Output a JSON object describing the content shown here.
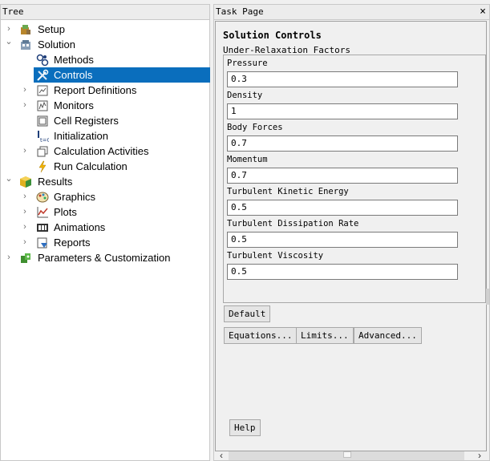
{
  "tree": {
    "header": "Tree",
    "items": [
      {
        "label": "Setup",
        "arrow": "›",
        "icon": "setup-icon"
      },
      {
        "label": "Solution",
        "arrow": "⌄",
        "icon": "solution-icon"
      },
      {
        "label": "Methods",
        "arrow": "",
        "icon": "methods-icon"
      },
      {
        "label": "Controls",
        "arrow": "",
        "icon": "controls-icon"
      },
      {
        "label": "Report Definitions",
        "arrow": "›",
        "icon": "report-definitions-icon"
      },
      {
        "label": "Monitors",
        "arrow": "›",
        "icon": "monitors-icon"
      },
      {
        "label": "Cell Registers",
        "arrow": "",
        "icon": "cell-registers-icon"
      },
      {
        "label": "Initialization",
        "arrow": "",
        "icon": "initialization-icon"
      },
      {
        "label": "Calculation Activities",
        "arrow": "›",
        "icon": "calculation-activities-icon"
      },
      {
        "label": "Run Calculation",
        "arrow": "",
        "icon": "run-calculation-icon"
      },
      {
        "label": "Results",
        "arrow": "⌄",
        "icon": "results-icon"
      },
      {
        "label": "Graphics",
        "arrow": "›",
        "icon": "graphics-icon"
      },
      {
        "label": "Plots",
        "arrow": "›",
        "icon": "plots-icon"
      },
      {
        "label": "Animations",
        "arrow": "›",
        "icon": "animations-icon"
      },
      {
        "label": "Reports",
        "arrow": "›",
        "icon": "reports-icon"
      },
      {
        "label": "Parameters & Customization",
        "arrow": "›",
        "icon": "parameters-icon"
      }
    ],
    "selected": "Controls",
    "selection_color": "#0a6ebd"
  },
  "task": {
    "header": "Task Page",
    "close": "×",
    "title": "Solution Controls",
    "group_label": "Under-Relaxation Factors",
    "fields": [
      {
        "label": "Pressure",
        "value": "0.3"
      },
      {
        "label": "Density",
        "value": "1"
      },
      {
        "label": "Body Forces",
        "value": "0.7"
      },
      {
        "label": "Momentum",
        "value": "0.7"
      },
      {
        "label": "Turbulent Kinetic Energy",
        "value": "0.5"
      },
      {
        "label": "Turbulent Dissipation Rate",
        "value": "0.5"
      },
      {
        "label": "Turbulent Viscosity",
        "value": "0.5"
      }
    ],
    "buttons": {
      "default": "Default",
      "equations": "Equations...",
      "limits": "Limits...",
      "advanced": "Advanced...",
      "help": "Help"
    },
    "scroll_left": "‹",
    "scroll_right": "›"
  }
}
